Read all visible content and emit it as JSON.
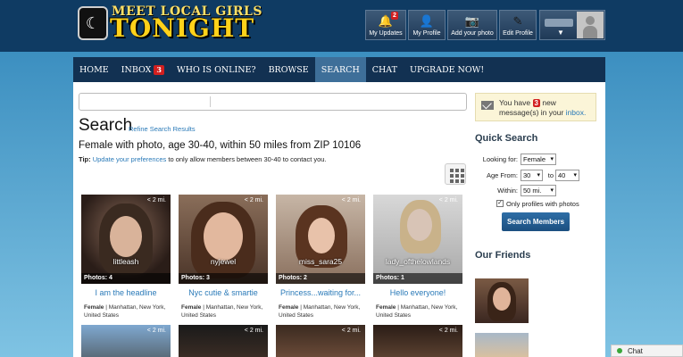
{
  "header": {
    "logo_top": "MEET LOCAL GIRLS",
    "logo_main": "TONIGHT",
    "buttons": [
      {
        "label": "My Updates",
        "icon": "bell-icon",
        "badge": "2"
      },
      {
        "label": "My Profile",
        "icon": "person-icon"
      },
      {
        "label": "Add your photo",
        "icon": "camera-icon"
      },
      {
        "label": "Edit Profile",
        "icon": "pencil-icon"
      }
    ],
    "user_caret": "▼"
  },
  "nav": {
    "home": "HOME",
    "inbox": "INBOX",
    "inbox_badge": "3",
    "who_online": "WHO IS ONLINE?",
    "browse": "BROWSE",
    "search": "SEARCH",
    "chat": "CHAT",
    "upgrade": "UPGRADE NOW!"
  },
  "search": {
    "title": "Search",
    "refine": "Refine Search Results",
    "criteria": "Female with photo, age 30-40, within 50 miles from ZIP 10106",
    "tip_label": "Tip:",
    "tip_link": "Update your preferences",
    "tip_rest": "to only allow members between 30-40 to contact you."
  },
  "results": [
    {
      "distance": "< 2 mi.",
      "username": "littleash",
      "photos": "Photos: 4",
      "headline": "I am the headline",
      "gender": "Female",
      "location": "Manhattan, New York, United States"
    },
    {
      "distance": "< 2 mi.",
      "username": "nyjewel",
      "photos": "Photos: 3",
      "headline": "Nyc cutie & smartie",
      "gender": "Female",
      "location": "Manhattan, New York, United States"
    },
    {
      "distance": "< 2 mi.",
      "username": "miss_sara25",
      "photos": "Photos: 2",
      "headline": "Princess...waiting for...",
      "gender": "Female",
      "location": "Manhattan, New York, United States"
    },
    {
      "distance": "< 2 mi.",
      "username": "lady_ofthelowlands",
      "photos": "Photos: 1",
      "headline": "Hello everyone!",
      "gender": "Female",
      "location": "Manhattan, New York, United States"
    }
  ],
  "results_row2": [
    {
      "distance": "< 2 mi."
    },
    {
      "distance": "< 2 mi."
    },
    {
      "distance": "< 2 mi."
    },
    {
      "distance": "< 2 mi."
    }
  ],
  "inbox_notice": {
    "pre": "You have",
    "count": "3",
    "mid": "new message(s) in your",
    "link": "inbox."
  },
  "quick_search": {
    "title": "Quick Search",
    "looking_for_label": "Looking for:",
    "looking_for_value": "Female",
    "age_from_label": "Age From:",
    "age_from_value": "30",
    "age_to_label": "to",
    "age_to_value": "40",
    "within_label": "Within:",
    "within_value": "50 mi.",
    "photos_only_label": "Only profiles with photos",
    "photos_only_checked": "✓",
    "button": "Search Members"
  },
  "friends": {
    "title": "Our Friends"
  },
  "chat_tab": {
    "label": "Chat"
  },
  "colors": {
    "header_bg": "#0f3b63",
    "nav_bg": "#123152",
    "nav_active": "#3e6f99",
    "link": "#2a7ab8",
    "badge": "#d21f1f"
  }
}
